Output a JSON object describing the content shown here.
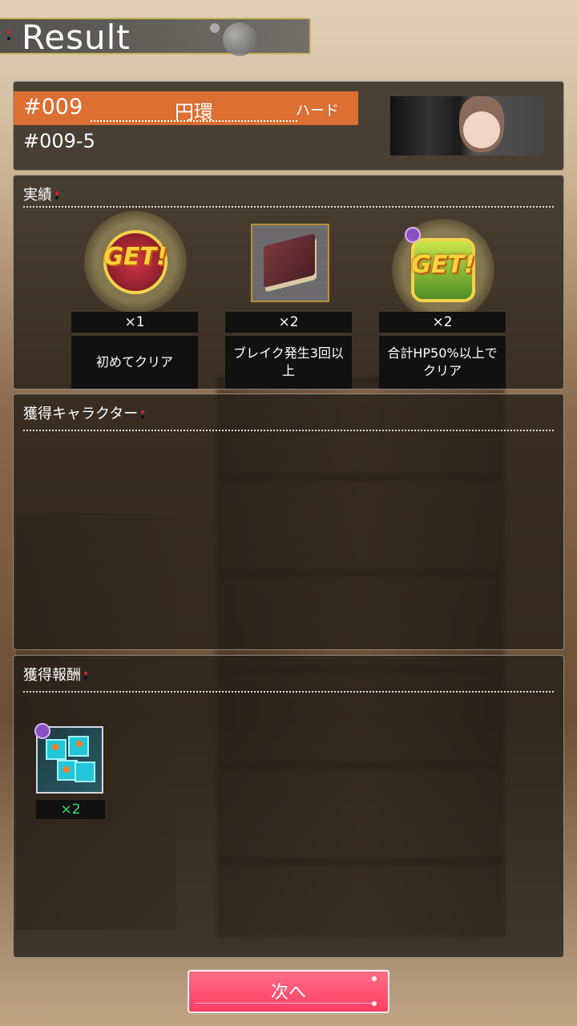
{
  "header": {
    "title": "Result"
  },
  "stage": {
    "number": "#009",
    "name": "円環",
    "difficulty": "ハード",
    "sub_id": "#009-5"
  },
  "achievements": {
    "title": "実績",
    "items": [
      {
        "count": "×1",
        "label": "初めてクリア",
        "get": "GET!"
      },
      {
        "count": "×2",
        "label": "ブレイク発生3回以上"
      },
      {
        "count": "×2",
        "label": "合計HP50%以上でクリア",
        "get": "GET!"
      }
    ]
  },
  "characters": {
    "title": "獲得キャラクター"
  },
  "rewards": {
    "title": "獲得報酬",
    "items": [
      {
        "count": "×2"
      }
    ]
  },
  "next_button": {
    "label": "次へ"
  },
  "colors": {
    "accent": "#dc6f32",
    "button": "#ff4d6d",
    "reward_count": "#2ee66b"
  }
}
